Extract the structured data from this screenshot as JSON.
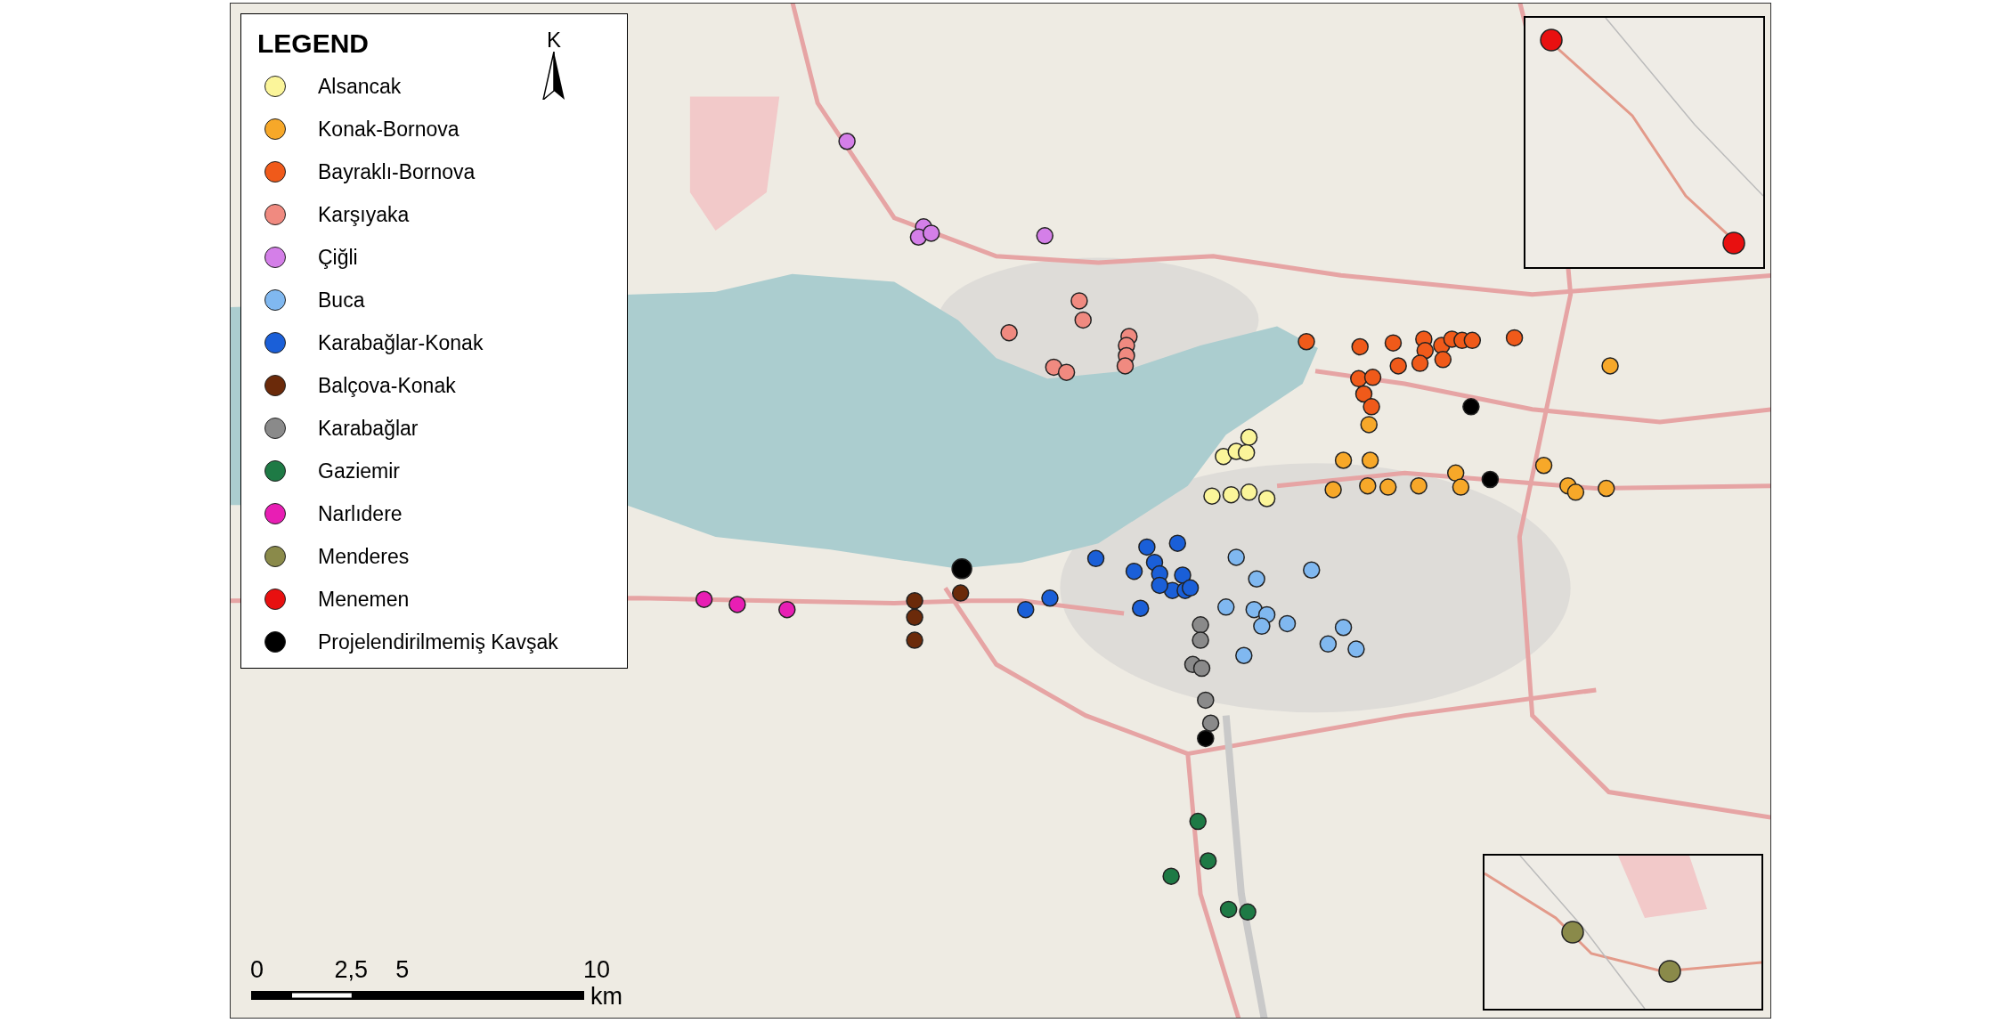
{
  "legend": {
    "title": "LEGEND",
    "items": [
      {
        "label": "Alsancak",
        "color": "#fbf59a"
      },
      {
        "label": "Konak-Bornova",
        "color": "#f7a829"
      },
      {
        "label": "Bayraklı-Bornova",
        "color": "#f05a1a"
      },
      {
        "label": "Karşıyaka",
        "color": "#f08a80"
      },
      {
        "label": "Çiğli",
        "color": "#d47fe8"
      },
      {
        "label": "Buca",
        "color": "#80b8f0"
      },
      {
        "label": "Karabağlar-Konak",
        "color": "#1a5fd8"
      },
      {
        "label": "Balçova-Konak",
        "color": "#6b2a0a"
      },
      {
        "label": "Karabağlar",
        "color": "#8a8a8a"
      },
      {
        "label": "Gaziemir",
        "color": "#1e7a45"
      },
      {
        "label": "Narlıdere",
        "color": "#e81eb4"
      },
      {
        "label": "Menderes",
        "color": "#8a8a4a"
      },
      {
        "label": "Menemen",
        "color": "#e81010"
      },
      {
        "label": "Projelendirilmemiş Kavşak",
        "color": "#000000"
      }
    ]
  },
  "north_arrow": {
    "letter": "K"
  },
  "scale_bar": {
    "ticks": [
      "0",
      "2,5",
      "5",
      "10"
    ],
    "unit": "km"
  }
}
